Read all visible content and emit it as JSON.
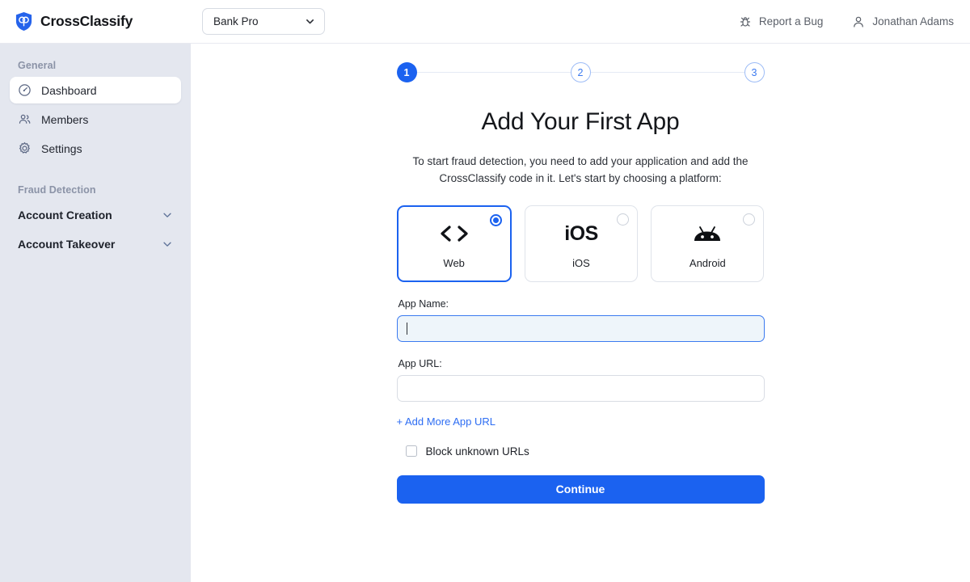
{
  "topbar": {
    "brand_name": "CrossClassify",
    "brand_logo_icon": "shield-logo-icon",
    "org_selector": {
      "value": "Bank Pro",
      "chevron_icon": "chevron-down-icon"
    },
    "report_bug": {
      "label": "Report a Bug",
      "icon": "bug-icon"
    },
    "user": {
      "label": "Jonathan Adams",
      "icon": "person-icon"
    }
  },
  "sidebar": {
    "section_general": "General",
    "items": [
      {
        "label": "Dashboard",
        "icon": "gauge-icon",
        "active": true
      },
      {
        "label": "Members",
        "icon": "people-icon",
        "active": false
      },
      {
        "label": "Settings",
        "icon": "gear-icon",
        "active": false
      }
    ],
    "section_fraud": "Fraud Detection",
    "groups": [
      {
        "label": "Account Creation",
        "icon": "chevron-down-icon"
      },
      {
        "label": "Account Takeover",
        "icon": "chevron-down-icon"
      }
    ]
  },
  "stepper": {
    "steps": [
      {
        "number": "1",
        "state": "done"
      },
      {
        "number": "2",
        "state": "todo"
      },
      {
        "number": "3",
        "state": "todo"
      }
    ]
  },
  "main": {
    "title": "Add Your First App",
    "subtitle": "To start fraud detection, you need to add your application and add the CrossClassify code in it. Let's start by choosing a platform:",
    "platforms": [
      {
        "label": "Web",
        "icon": "code-brackets-icon",
        "selected": true
      },
      {
        "label": "iOS",
        "icon": "ios-text-icon",
        "glyph": "iOS",
        "selected": false
      },
      {
        "label": "Android",
        "icon": "android-robot-icon",
        "selected": false
      }
    ],
    "app_name": {
      "label": "App Name:",
      "value": "",
      "placeholder": "",
      "focused": true
    },
    "app_url": {
      "label": "App URL:",
      "value": "",
      "placeholder": ""
    },
    "add_more_url_link": "+ Add More App URL",
    "block_unknown_urls": {
      "label": "Block unknown URLs",
      "checked": false
    },
    "continue_label": "Continue"
  },
  "colors": {
    "accent": "#1b62f0",
    "sidebar_bg": "#e4e7ef",
    "link": "#2d6df3",
    "focus_field_bg": "#eef5fa"
  }
}
